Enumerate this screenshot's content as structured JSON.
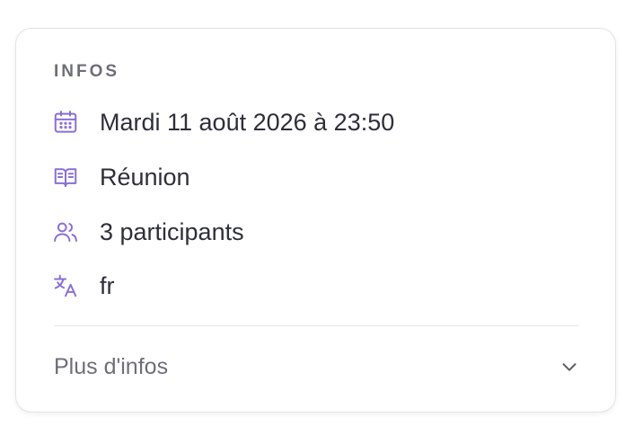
{
  "card": {
    "heading": "INFOS",
    "rows": [
      {
        "icon": "calendar-icon",
        "text": "Mardi 11 août 2026 à 23:50"
      },
      {
        "icon": "book-open-icon",
        "text": "Réunion"
      },
      {
        "icon": "users-icon",
        "text": "3 participants"
      },
      {
        "icon": "translate-icon",
        "text": "fr"
      }
    ],
    "more_label": "Plus d'infos",
    "more_icon": "chevron-down-icon"
  },
  "colors": {
    "accent": "#8b6fd6",
    "text": "#2f2f3a",
    "muted": "#6e6e78",
    "border": "#e3e3e6"
  }
}
